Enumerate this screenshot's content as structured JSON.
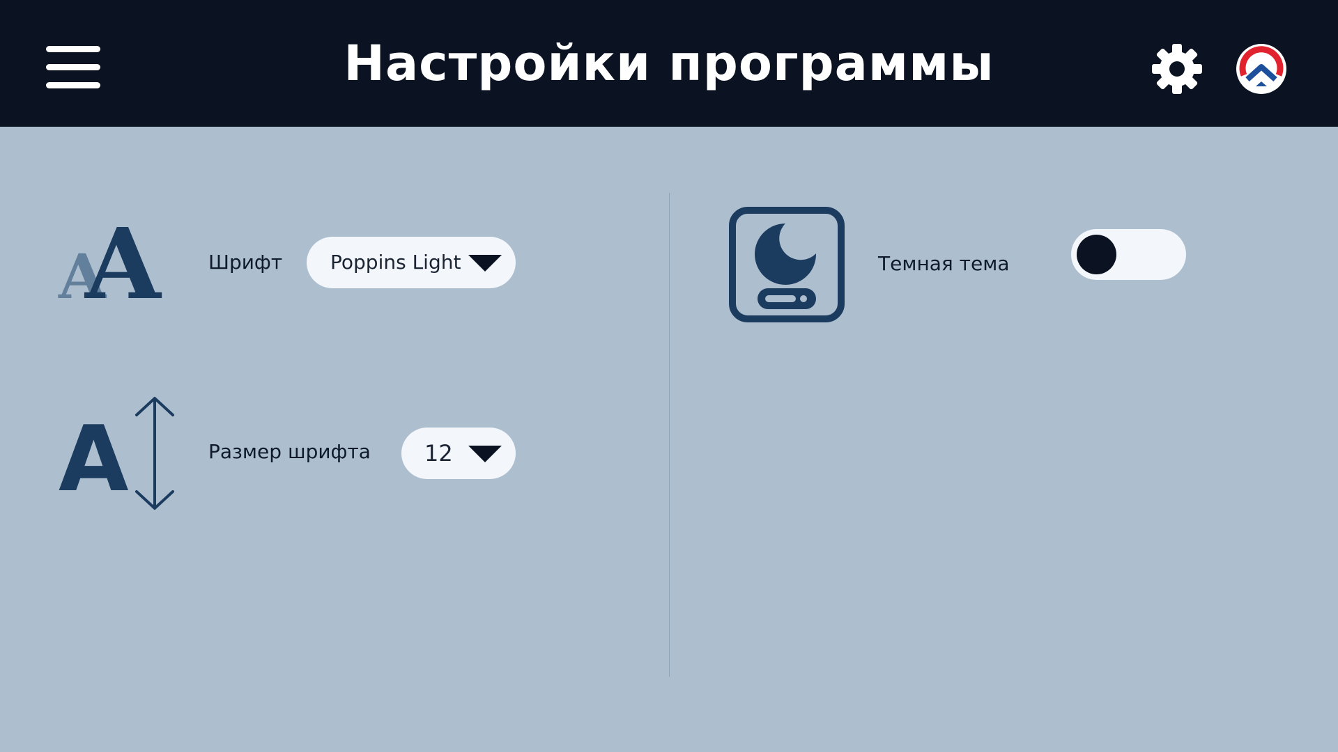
{
  "header": {
    "title": "Настройки программы",
    "menu_icon": "hamburger-menu-icon",
    "settings_icon": "gear-icon",
    "logo_icon": "brand-logo-icon"
  },
  "settings": {
    "font": {
      "label": "Шрифт",
      "value": "Poppins Light",
      "icon": "font-family-icon"
    },
    "font_size": {
      "label": "Размер шрифта",
      "value": "12",
      "icon": "font-size-icon"
    },
    "dark_theme": {
      "label": "Темная тема",
      "enabled": false,
      "icon": "night-mode-icon"
    }
  },
  "colors": {
    "header_bg": "#0b1221",
    "page_bg": "#adbfcf",
    "accent": "#1b3b5f",
    "control_bg": "#f3f6fb",
    "logo_red": "#e0232e",
    "logo_blue": "#1c4f9c"
  }
}
